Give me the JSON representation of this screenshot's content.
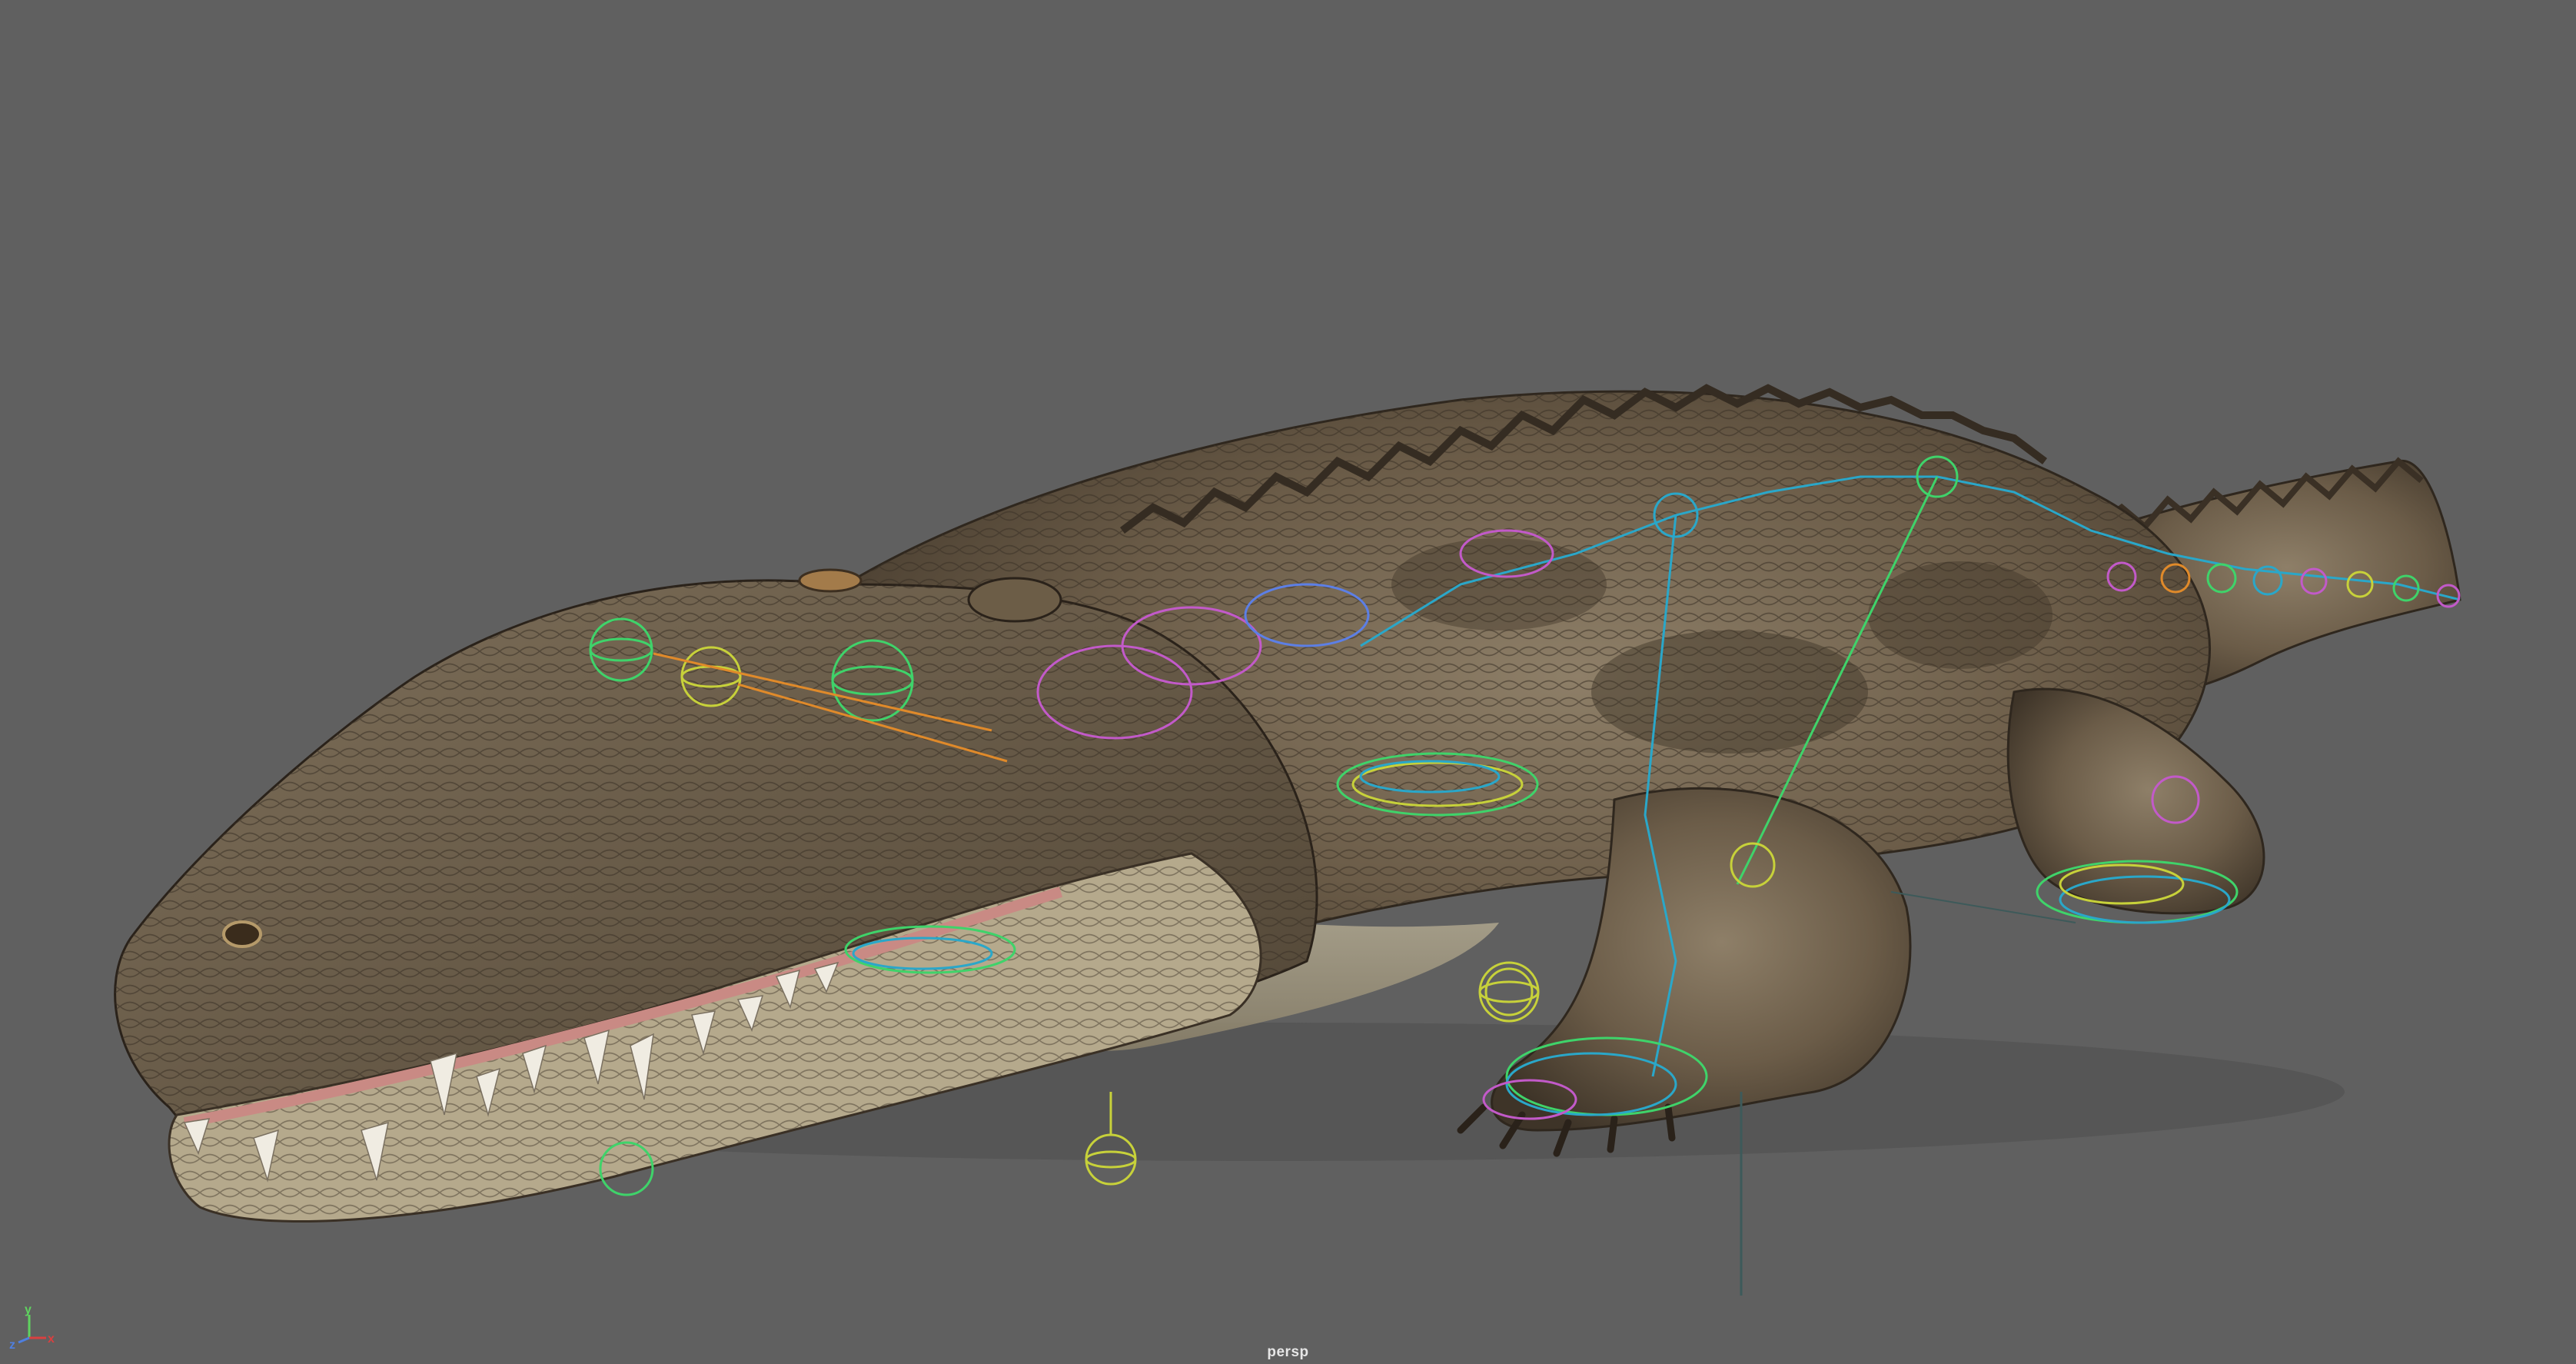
{
  "viewport": {
    "camera_label": "persp",
    "background": "#606060"
  },
  "axis_gizmo": {
    "x_label": "x",
    "y_label": "y",
    "z_label": "z",
    "x_color": "#d94040",
    "y_color": "#5fd35f",
    "z_color": "#4f7fe0"
  },
  "model": {
    "subject": "crocodile",
    "skin_color": "#7a6a55",
    "rig_colors": [
      "#3fd36a",
      "#2aa7c9",
      "#c7d13a",
      "#c25ac9",
      "#e08a2a",
      "#5c7fe6"
    ]
  }
}
